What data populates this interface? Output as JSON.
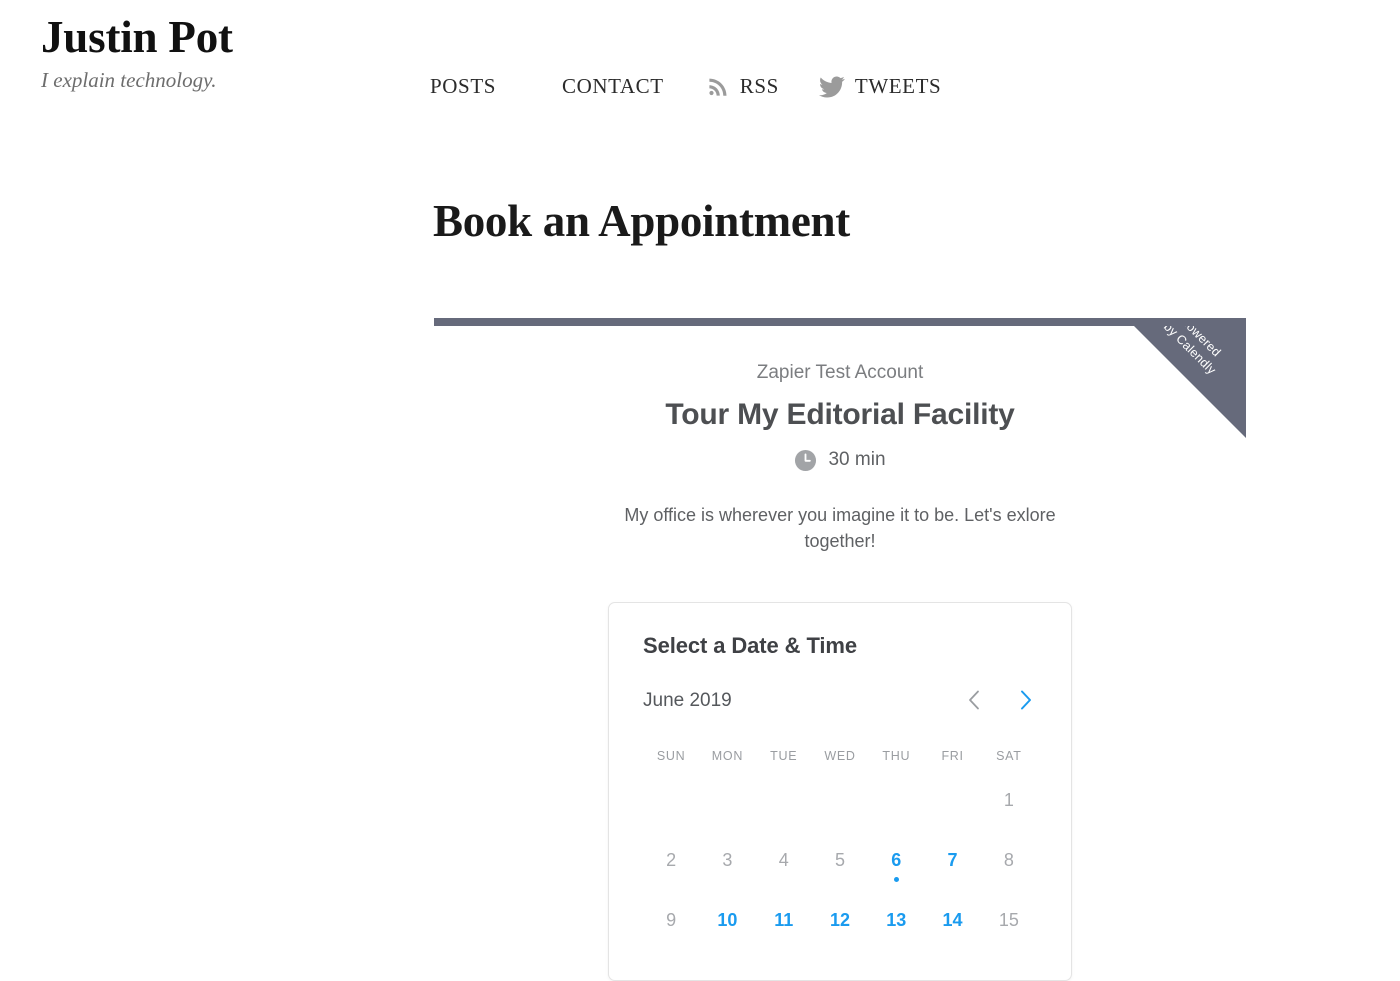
{
  "site": {
    "brand_name": "Justin Pot",
    "tagline": "I explain technology.",
    "nav": [
      {
        "label": "POSTS",
        "icon": null
      },
      {
        "label": "CONTACT",
        "icon": null
      },
      {
        "label": "RSS",
        "icon": "rss-icon"
      },
      {
        "label": "TWEETS",
        "icon": "twitter-icon"
      }
    ]
  },
  "page": {
    "title": "Book an Appointment"
  },
  "calendly": {
    "ribbon_line1": "powered",
    "ribbon_line2": "by Calendly",
    "owner": "Zapier Test Account",
    "event_name": "Tour My Editorial Facility",
    "duration": "30 min",
    "duration_icon": "clock-icon",
    "description": "My office is wherever you imagine it to be. Let's exlore together!",
    "accent_color": "#1a9bef",
    "header_color": "#666a7b",
    "calendar": {
      "heading": "Select a Date & Time",
      "month_label": "June 2019",
      "prev_label": "chevron-left-icon",
      "next_label": "chevron-right-icon",
      "prev_enabled": false,
      "next_enabled": true,
      "weekdays": [
        "SUN",
        "MON",
        "TUE",
        "WED",
        "THU",
        "FRI",
        "SAT"
      ],
      "days": [
        {
          "label": "",
          "state": "empty"
        },
        {
          "label": "",
          "state": "empty"
        },
        {
          "label": "",
          "state": "empty"
        },
        {
          "label": "",
          "state": "empty"
        },
        {
          "label": "",
          "state": "empty"
        },
        {
          "label": "",
          "state": "empty"
        },
        {
          "label": "1",
          "state": "unavailable"
        },
        {
          "label": "2",
          "state": "unavailable"
        },
        {
          "label": "3",
          "state": "unavailable"
        },
        {
          "label": "4",
          "state": "unavailable"
        },
        {
          "label": "5",
          "state": "unavailable"
        },
        {
          "label": "6",
          "state": "today"
        },
        {
          "label": "7",
          "state": "available"
        },
        {
          "label": "8",
          "state": "unavailable"
        },
        {
          "label": "9",
          "state": "unavailable"
        },
        {
          "label": "10",
          "state": "available"
        },
        {
          "label": "11",
          "state": "available"
        },
        {
          "label": "12",
          "state": "available"
        },
        {
          "label": "13",
          "state": "available"
        },
        {
          "label": "14",
          "state": "available"
        },
        {
          "label": "15",
          "state": "unavailable"
        }
      ]
    }
  }
}
